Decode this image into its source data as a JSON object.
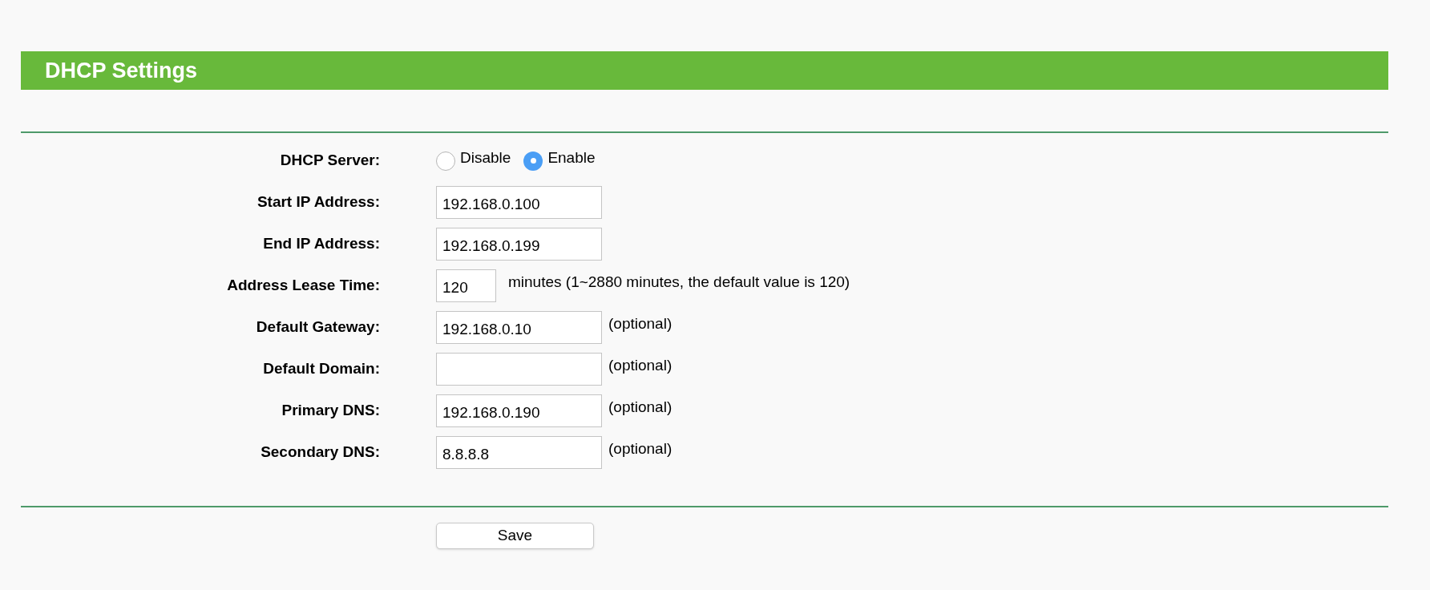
{
  "header": {
    "title": "DHCP Settings"
  },
  "rows": [
    {
      "kind": "radio",
      "label": "DHCP Server:",
      "options": [
        {
          "label": "Disable",
          "selected": false
        },
        {
          "label": "Enable",
          "selected": true
        }
      ]
    },
    {
      "kind": "field",
      "label": "Start IP Address:",
      "value": "192.168.0.100"
    },
    {
      "kind": "field",
      "label": "End IP Address:",
      "value": "192.168.0.199"
    },
    {
      "kind": "short",
      "label": "Address Lease Time:",
      "value": "120",
      "note": "minutes (1~2880 minutes, the default value is 120)"
    },
    {
      "kind": "field",
      "label": "Default Gateway:",
      "value": "192.168.0.10",
      "note": "(optional)"
    },
    {
      "kind": "field",
      "label": "Default Domain:",
      "note": "(optional)"
    },
    {
      "kind": "field",
      "label": "Primary DNS:",
      "value": "192.168.0.190",
      "note": "(optional)"
    },
    {
      "kind": "field",
      "label": "Secondary DNS:",
      "value": "8.8.8.8",
      "note": "(optional)"
    }
  ],
  "save_button": "Save"
}
